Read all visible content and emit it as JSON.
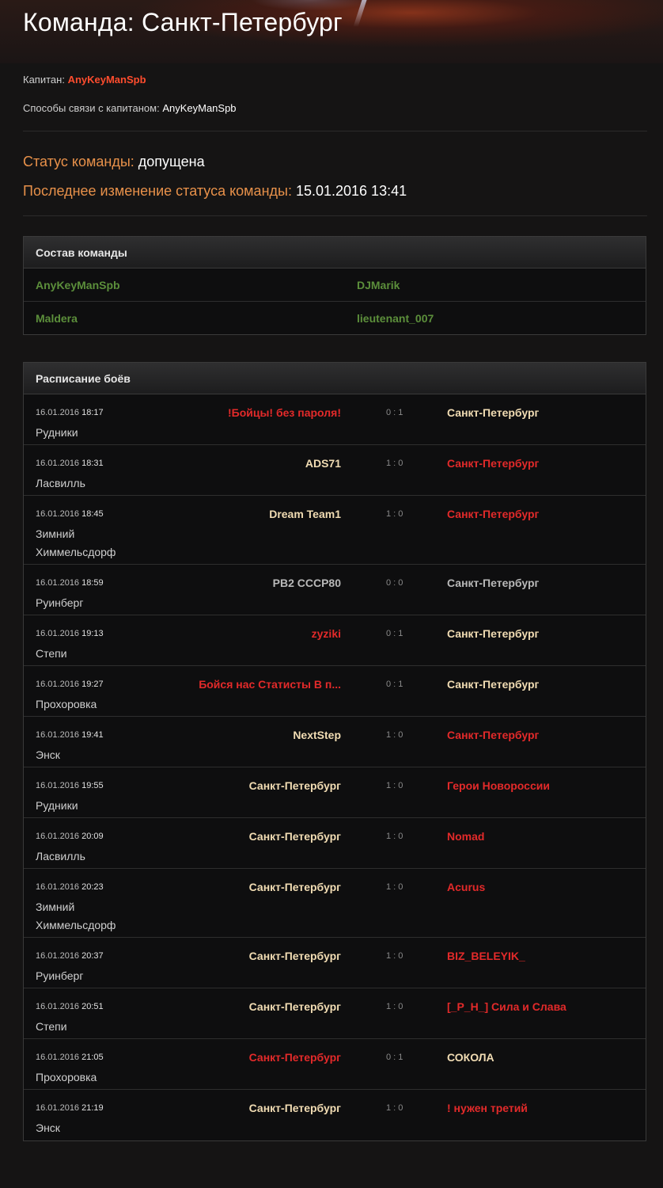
{
  "header": {
    "title": "Команда: Санкт-Петербург"
  },
  "info": {
    "captain_label": "Капитан:",
    "captain_name": "AnyKeyManSpb",
    "contact_label": "Способы связи с капитаном:",
    "contact_value": "AnyKeyManSpb"
  },
  "status": {
    "status_label": "Статус команды:",
    "status_value": "допущена",
    "changed_label": "Последнее изменение статуса команды:",
    "changed_value": "15.01.2016 13:41"
  },
  "roster": {
    "title": "Состав команды",
    "rows": [
      [
        "AnyKeyManSpb",
        "DJMarik"
      ],
      [
        "Maldera",
        "lieutenant_007"
      ]
    ]
  },
  "schedule": {
    "title": "Расписание боёв",
    "matches": [
      {
        "date": "16.01.2016",
        "time": "18:17",
        "map": "Рудники",
        "team1": "!Бойцы! без пароля!",
        "score": "0 : 1",
        "team2": "Санкт-Петербург",
        "t1_class": "loss",
        "t2_class": "win"
      },
      {
        "date": "16.01.2016",
        "time": "18:31",
        "map": "Ласвилль",
        "team1": "ADS71",
        "score": "1 : 0",
        "team2": "Санкт-Петербург",
        "t1_class": "win",
        "t2_class": "loss"
      },
      {
        "date": "16.01.2016",
        "time": "18:45",
        "map": "Зимний Химмельсдорф",
        "team1": "Dream Team1",
        "score": "1 : 0",
        "team2": "Санкт-Петербург",
        "t1_class": "win",
        "t2_class": "loss"
      },
      {
        "date": "16.01.2016",
        "time": "18:59",
        "map": "Руинберг",
        "team1": "PB2 CCCP80",
        "score": "0 : 0",
        "team2": "Санкт-Петербург",
        "t1_class": "draw",
        "t2_class": "draw"
      },
      {
        "date": "16.01.2016",
        "time": "19:13",
        "map": "Степи",
        "team1": "zyziki",
        "score": "0 : 1",
        "team2": "Санкт-Петербург",
        "t1_class": "loss",
        "t2_class": "win"
      },
      {
        "date": "16.01.2016",
        "time": "19:27",
        "map": "Прохоровка",
        "team1": "Бойся нас Статисты В п...",
        "score": "0 : 1",
        "team2": "Санкт-Петербург",
        "t1_class": "loss",
        "t2_class": "win"
      },
      {
        "date": "16.01.2016",
        "time": "19:41",
        "map": "Энск",
        "team1": "NextStep",
        "score": "1 : 0",
        "team2": "Санкт-Петербург",
        "t1_class": "win",
        "t2_class": "loss"
      },
      {
        "date": "16.01.2016",
        "time": "19:55",
        "map": "Рудники",
        "team1": "Санкт-Петербург",
        "score": "1 : 0",
        "team2": "Герои Новороссии",
        "t1_class": "win",
        "t2_class": "loss"
      },
      {
        "date": "16.01.2016",
        "time": "20:09",
        "map": "Ласвилль",
        "team1": "Санкт-Петербург",
        "score": "1 : 0",
        "team2": "Nomad",
        "t1_class": "win",
        "t2_class": "loss"
      },
      {
        "date": "16.01.2016",
        "time": "20:23",
        "map": "Зимний Химмельсдорф",
        "team1": "Санкт-Петербург",
        "score": "1 : 0",
        "team2": "Acurus",
        "t1_class": "win",
        "t2_class": "loss"
      },
      {
        "date": "16.01.2016",
        "time": "20:37",
        "map": "Руинберг",
        "team1": "Санкт-Петербург",
        "score": "1 : 0",
        "team2": "BIZ_BELEYIK_",
        "t1_class": "win",
        "t2_class": "loss"
      },
      {
        "date": "16.01.2016",
        "time": "20:51",
        "map": "Степи",
        "team1": "Санкт-Петербург",
        "score": "1 : 0",
        "team2": "[_P_H_] Сила и Слава",
        "t1_class": "win",
        "t2_class": "loss"
      },
      {
        "date": "16.01.2016",
        "time": "21:05",
        "map": "Прохоровка",
        "team1": "Санкт-Петербург",
        "score": "0 : 1",
        "team2": "СОКОЛА",
        "t1_class": "loss",
        "t2_class": "win"
      },
      {
        "date": "16.01.2016",
        "time": "21:19",
        "map": "Энск",
        "team1": "Санкт-Петербург",
        "score": "1 : 0",
        "team2": "! нужен третий",
        "t1_class": "win",
        "t2_class": "loss"
      }
    ]
  }
}
